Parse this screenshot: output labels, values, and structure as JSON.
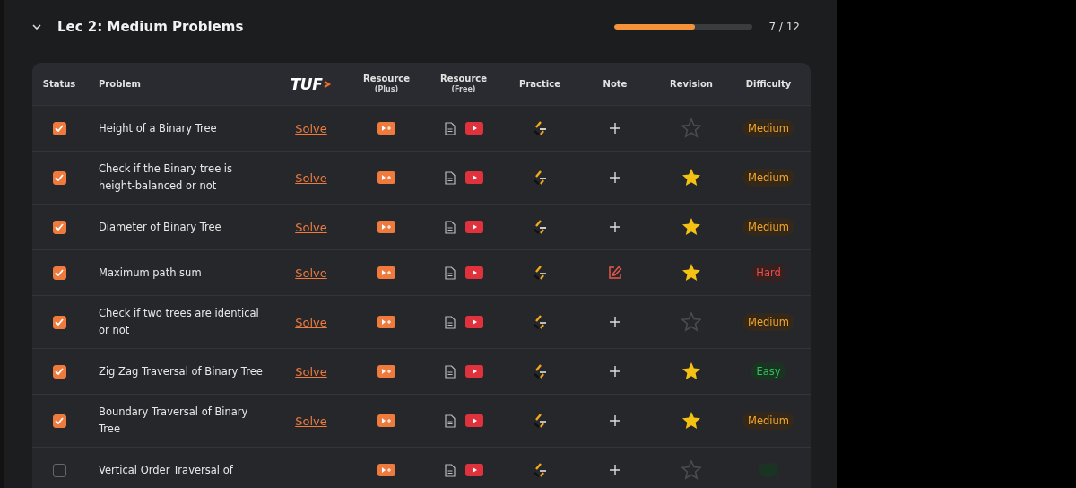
{
  "section": {
    "title": "Lec 2: Medium Problems",
    "expanded": true,
    "progress": {
      "level": 0.583,
      "label": "7 / 12"
    }
  },
  "table": {
    "columns": [
      {
        "kind": "text",
        "label": "Status"
      },
      {
        "kind": "text",
        "label": "Problem"
      },
      {
        "kind": "logo",
        "label": "TUF"
      },
      {
        "kind": "sub",
        "label": "Resource",
        "sub": "(Plus)"
      },
      {
        "kind": "sub",
        "label": "Resource",
        "sub": "(Free)"
      },
      {
        "kind": "text",
        "label": "Practice"
      },
      {
        "kind": "text",
        "label": "Note"
      },
      {
        "kind": "text",
        "label": "Revision"
      },
      {
        "kind": "text",
        "label": "Difficulty"
      }
    ],
    "rows": [
      {
        "checked": true,
        "problem": "Height of a Binary Tree",
        "link": "Solve",
        "has_note": false,
        "starred": false,
        "difficulty": {
          "kind": "medium",
          "label": "Medium"
        }
      },
      {
        "checked": true,
        "problem": "Check if the Binary tree is height-balanced or not",
        "link": "Solve",
        "has_note": false,
        "starred": true,
        "difficulty": {
          "kind": "medium",
          "label": "Medium"
        }
      },
      {
        "checked": true,
        "problem": "Diameter of Binary Tree",
        "link": "Solve",
        "has_note": false,
        "starred": true,
        "difficulty": {
          "kind": "medium",
          "label": "Medium"
        }
      },
      {
        "checked": true,
        "problem": "Maximum path sum",
        "link": "Solve",
        "has_note": true,
        "starred": true,
        "difficulty": {
          "kind": "hard",
          "label": "Hard"
        }
      },
      {
        "checked": true,
        "problem": "Check if two trees are identical or not",
        "link": "Solve",
        "has_note": false,
        "starred": false,
        "difficulty": {
          "kind": "medium",
          "label": "Medium"
        }
      },
      {
        "checked": true,
        "problem": "Zig Zag Traversal of Binary Tree",
        "link": "Solve",
        "has_note": false,
        "starred": true,
        "difficulty": {
          "kind": "easy",
          "label": "Easy"
        }
      },
      {
        "checked": true,
        "problem": "Boundary Traversal of Binary Tree",
        "link": "Solve",
        "has_note": false,
        "starred": true,
        "difficulty": {
          "kind": "medium",
          "label": "Medium"
        }
      },
      {
        "checked": false,
        "problem": "Vertical Order Traversal of",
        "has_note": false,
        "starred": false,
        "difficulty": {
          "kind": "easy"
        }
      }
    ]
  }
}
